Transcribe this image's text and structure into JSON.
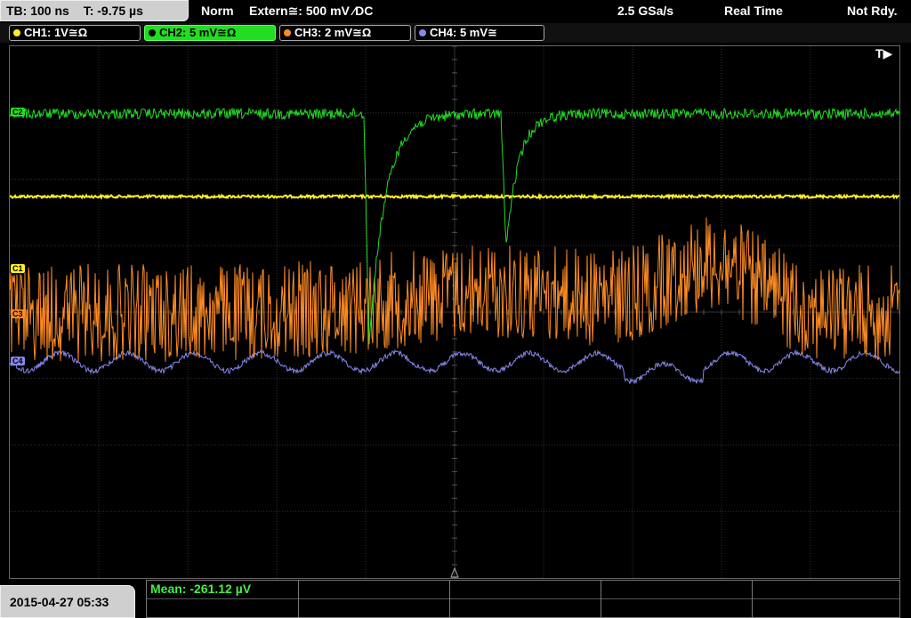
{
  "topbar": {
    "timebase": "TB: 100 ns",
    "trigger_time": "T: -9.75 µs",
    "mode": "Norm",
    "trigger_source": "Extern≅: 500 mV ⁄DC",
    "sample_rate": "2.5 GSa/s",
    "acq_mode": "Real Time",
    "status": "Not Rdy."
  },
  "channels": [
    {
      "label": "CH1: 1V≅Ω",
      "color": "#ffee22"
    },
    {
      "label": "CH2: 5 mV≅Ω",
      "color": "#22dd22"
    },
    {
      "label": "CH3: 2 mV≅Ω",
      "color": "#ff8c22"
    },
    {
      "label": "CH4: 5 mV≅",
      "color": "#8888ee"
    }
  ],
  "markers": {
    "ch2": "C2",
    "ch1": "C1",
    "ch3": "C3",
    "ch4": "C4"
  },
  "trigger_marker": "T▶",
  "bottom": {
    "datetime": "2015-04-27 05:33",
    "mean": "Mean: -261.12 µV"
  }
}
